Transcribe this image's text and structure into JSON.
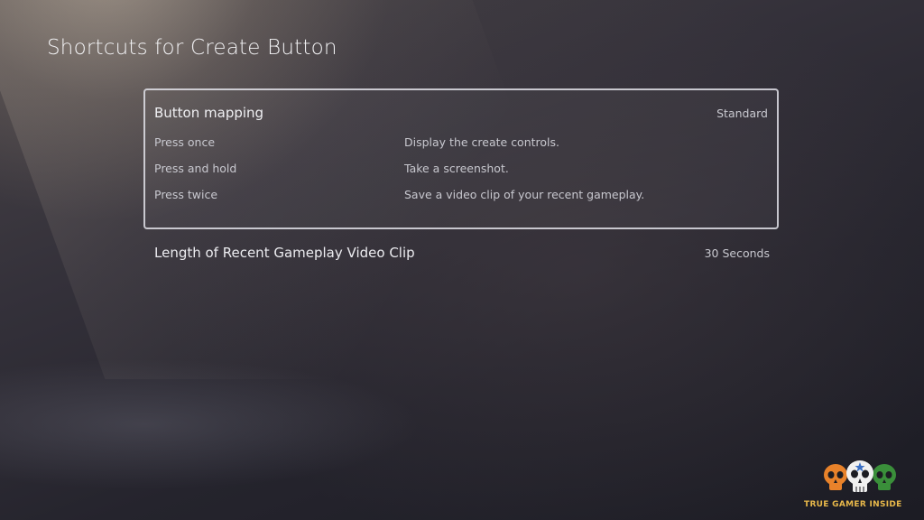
{
  "page": {
    "title": "Shortcuts for Create Button"
  },
  "button_mapping": {
    "label": "Button mapping",
    "value": "Standard",
    "rows": [
      {
        "action": "Press once",
        "result": "Display the create controls."
      },
      {
        "action": "Press and hold",
        "result": "Take a screenshot."
      },
      {
        "action": "Press twice",
        "result": "Save a video clip of your recent gameplay."
      }
    ]
  },
  "clip_length": {
    "label": "Length of Recent Gameplay Video Clip",
    "value": "30 Seconds"
  },
  "watermark": {
    "text": "TRUE GAMER INSIDE",
    "colors": {
      "left_skull": "#e8822a",
      "center_skull": "#f0f0f0",
      "right_skull": "#3a8f3a",
      "star": "#3a6fc4",
      "text": "#e8b84a"
    }
  },
  "colors": {
    "panel_border": "#e1e1e8",
    "text_primary": "#f0f0f3",
    "text_secondary": "#c8c8cf"
  }
}
